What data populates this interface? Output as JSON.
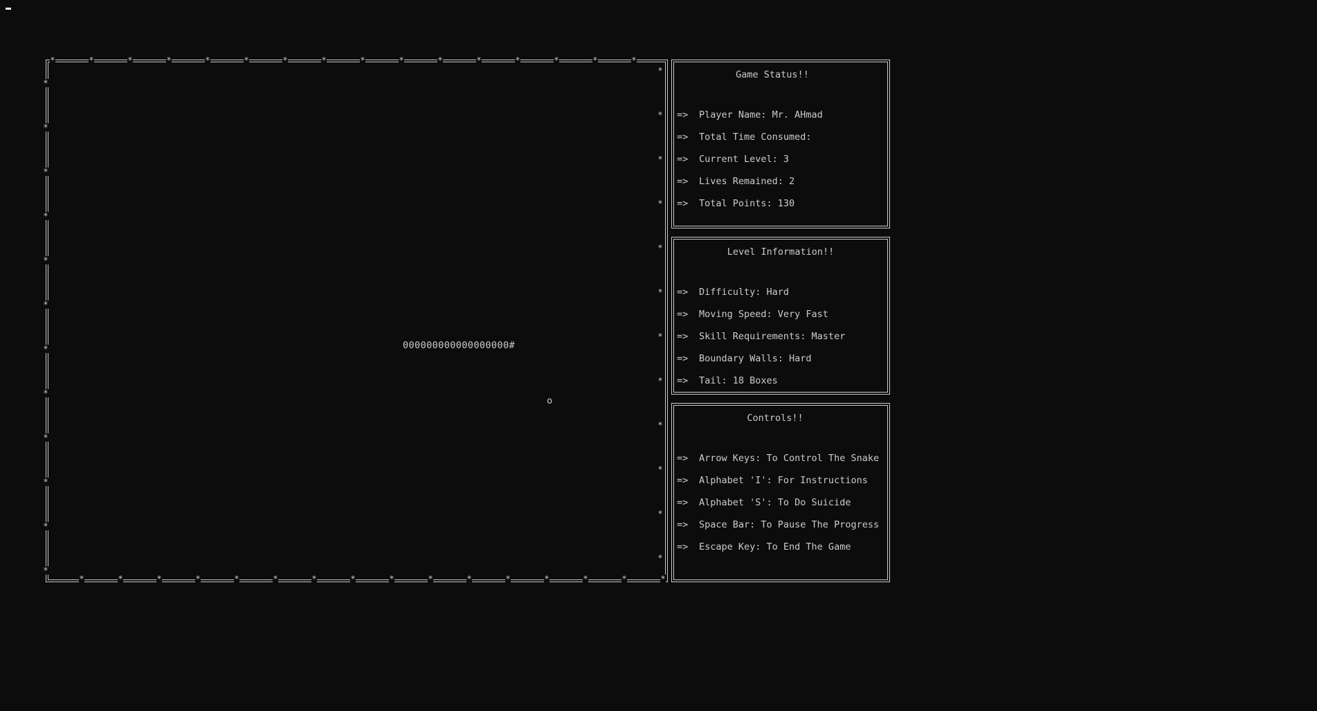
{
  "board": {
    "snake": "000000000000000000#",
    "food": "o",
    "border_marker": "*"
  },
  "game_status": {
    "title": "Game Status!!",
    "arrow": "=>",
    "rows": [
      "Player Name: Mr. AHmad",
      "Total Time Consumed:",
      "Current Level: 3",
      "Lives Remained: 2",
      "Total Points: 130"
    ]
  },
  "level_info": {
    "title": "Level Information!!",
    "arrow": "=>",
    "rows": [
      "Difficulty: Hard",
      "Moving Speed: Very Fast",
      "Skill Requirements: Master",
      "Boundary Walls: Hard",
      "Tail: 18 Boxes"
    ]
  },
  "controls": {
    "title": "Controls!!",
    "arrow": "=>",
    "rows": [
      "Arrow Keys: To Control The Snake",
      "Alphabet 'I': For Instructions",
      "Alphabet 'S': To Do Suicide",
      "Space Bar: To Pause The Progress",
      "Escape Key: To End The Game"
    ]
  }
}
